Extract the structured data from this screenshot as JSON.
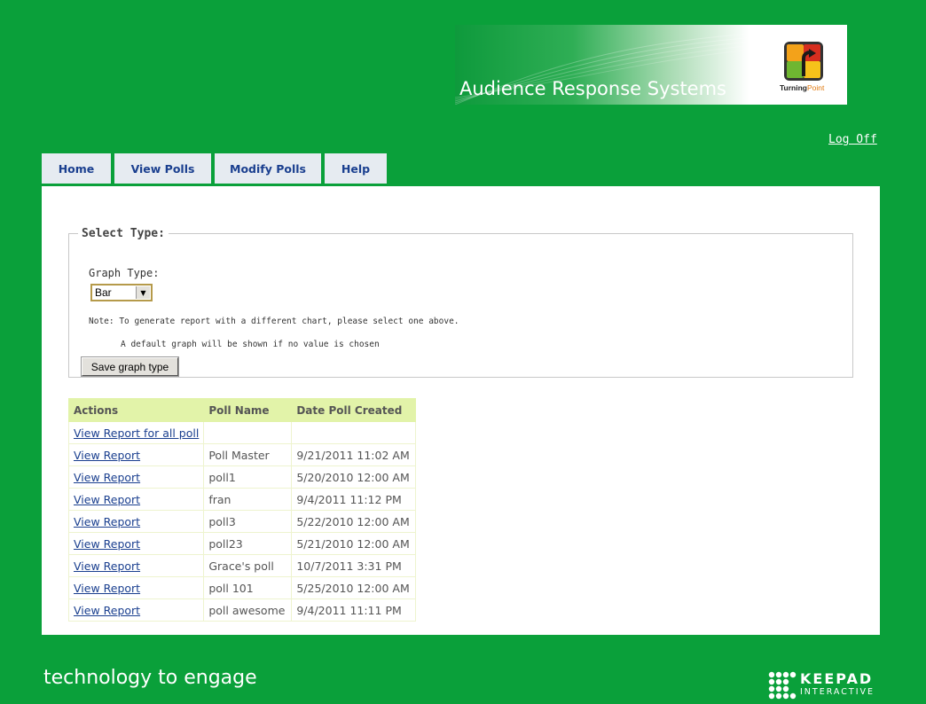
{
  "banner": {
    "title": "Audience Response Systems",
    "brand_logo_icon": "turningpoint-logo-icon",
    "brand_name_part1": "Turning",
    "brand_name_part2": "Point"
  },
  "header": {
    "logoff_label": "Log Off"
  },
  "tabs": [
    {
      "label": "Home"
    },
    {
      "label": "View Polls"
    },
    {
      "label": "Modify Polls"
    },
    {
      "label": "Help"
    }
  ],
  "select_type": {
    "legend": "Select Type:",
    "graph_type_label": "Graph Type:",
    "graph_type_value": "Bar",
    "note_line1": "Note: To generate report with a different chart, please select one above.",
    "note_line2": "A default graph will be shown if no value is chosen",
    "save_button_label": "Save graph type"
  },
  "polls_table": {
    "headers": [
      "Actions",
      "Poll Name",
      "Date Poll Created"
    ],
    "rows": [
      {
        "action": "View Report for all poll",
        "name": "",
        "date": ""
      },
      {
        "action": "View Report",
        "name": "Poll Master",
        "date": "9/21/2011 11:02 AM"
      },
      {
        "action": "View Report",
        "name": "poll1",
        "date": "5/20/2010 12:00 AM"
      },
      {
        "action": "View Report",
        "name": "fran",
        "date": "9/4/2011 11:12 PM"
      },
      {
        "action": "View Report",
        "name": "poll3",
        "date": "5/22/2010 12:00 AM"
      },
      {
        "action": "View Report",
        "name": "poll23",
        "date": "5/21/2010 12:00 AM"
      },
      {
        "action": "View Report",
        "name": "Grace's poll",
        "date": "10/7/2011 3:31 PM"
      },
      {
        "action": "View Report",
        "name": "poll 101",
        "date": "5/25/2010 12:00 AM"
      },
      {
        "action": "View Report",
        "name": "poll awesome",
        "date": "9/4/2011 11:11 PM"
      }
    ]
  },
  "footer": {
    "tagline": "technology to engage",
    "keypad_line1": "KEEPAD",
    "keypad_line2": "INTERACTIVE"
  },
  "colors": {
    "page_background": "#0aa03a",
    "tab_background": "#e6ebf1",
    "tab_text": "#1a3f8f",
    "table_header": "#e2f3a9",
    "link": "#1a3f8f"
  }
}
